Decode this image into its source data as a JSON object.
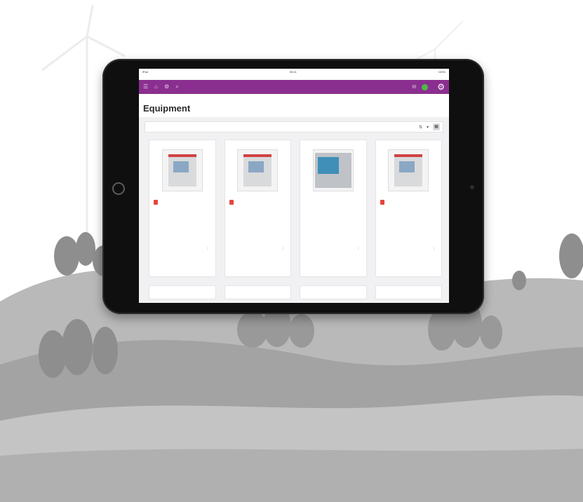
{
  "status": {
    "time": "09:41",
    "left": "iPad",
    "right": "100%"
  },
  "url": "",
  "appbar": {
    "user_name": ""
  },
  "breadcrumb": "",
  "page_title": "Equipment",
  "search_placeholder": "",
  "cards": [
    {
      "title": "",
      "badge": "",
      "lines": [
        "",
        "",
        "",
        "",
        ""
      ],
      "view_work": "",
      "quote": ""
    },
    {
      "title": "",
      "badge": "",
      "lines": [
        "",
        "",
        "",
        "",
        ""
      ],
      "view_work": "",
      "quote": ""
    },
    {
      "title": "",
      "badge": "",
      "lines": [
        "",
        "",
        "",
        "",
        ""
      ],
      "view_work": "",
      "quote": ""
    },
    {
      "title": "",
      "badge": "",
      "lines": [
        "",
        "",
        "",
        "",
        ""
      ],
      "view_work": "",
      "quote": ""
    }
  ],
  "next_cards": [
    "",
    "",
    "",
    ""
  ],
  "colors": {
    "accent": "#8a2f8f",
    "badge": "#e5453c",
    "user_dot": "#4fb947",
    "link": "#3a7cc1"
  },
  "icons": [
    "menu-icon",
    "home-icon",
    "settings-icon",
    "search-icon",
    "chat-icon",
    "gear-icon",
    "sort-icon",
    "filter-icon",
    "grid-view-icon",
    "more-icon"
  ]
}
